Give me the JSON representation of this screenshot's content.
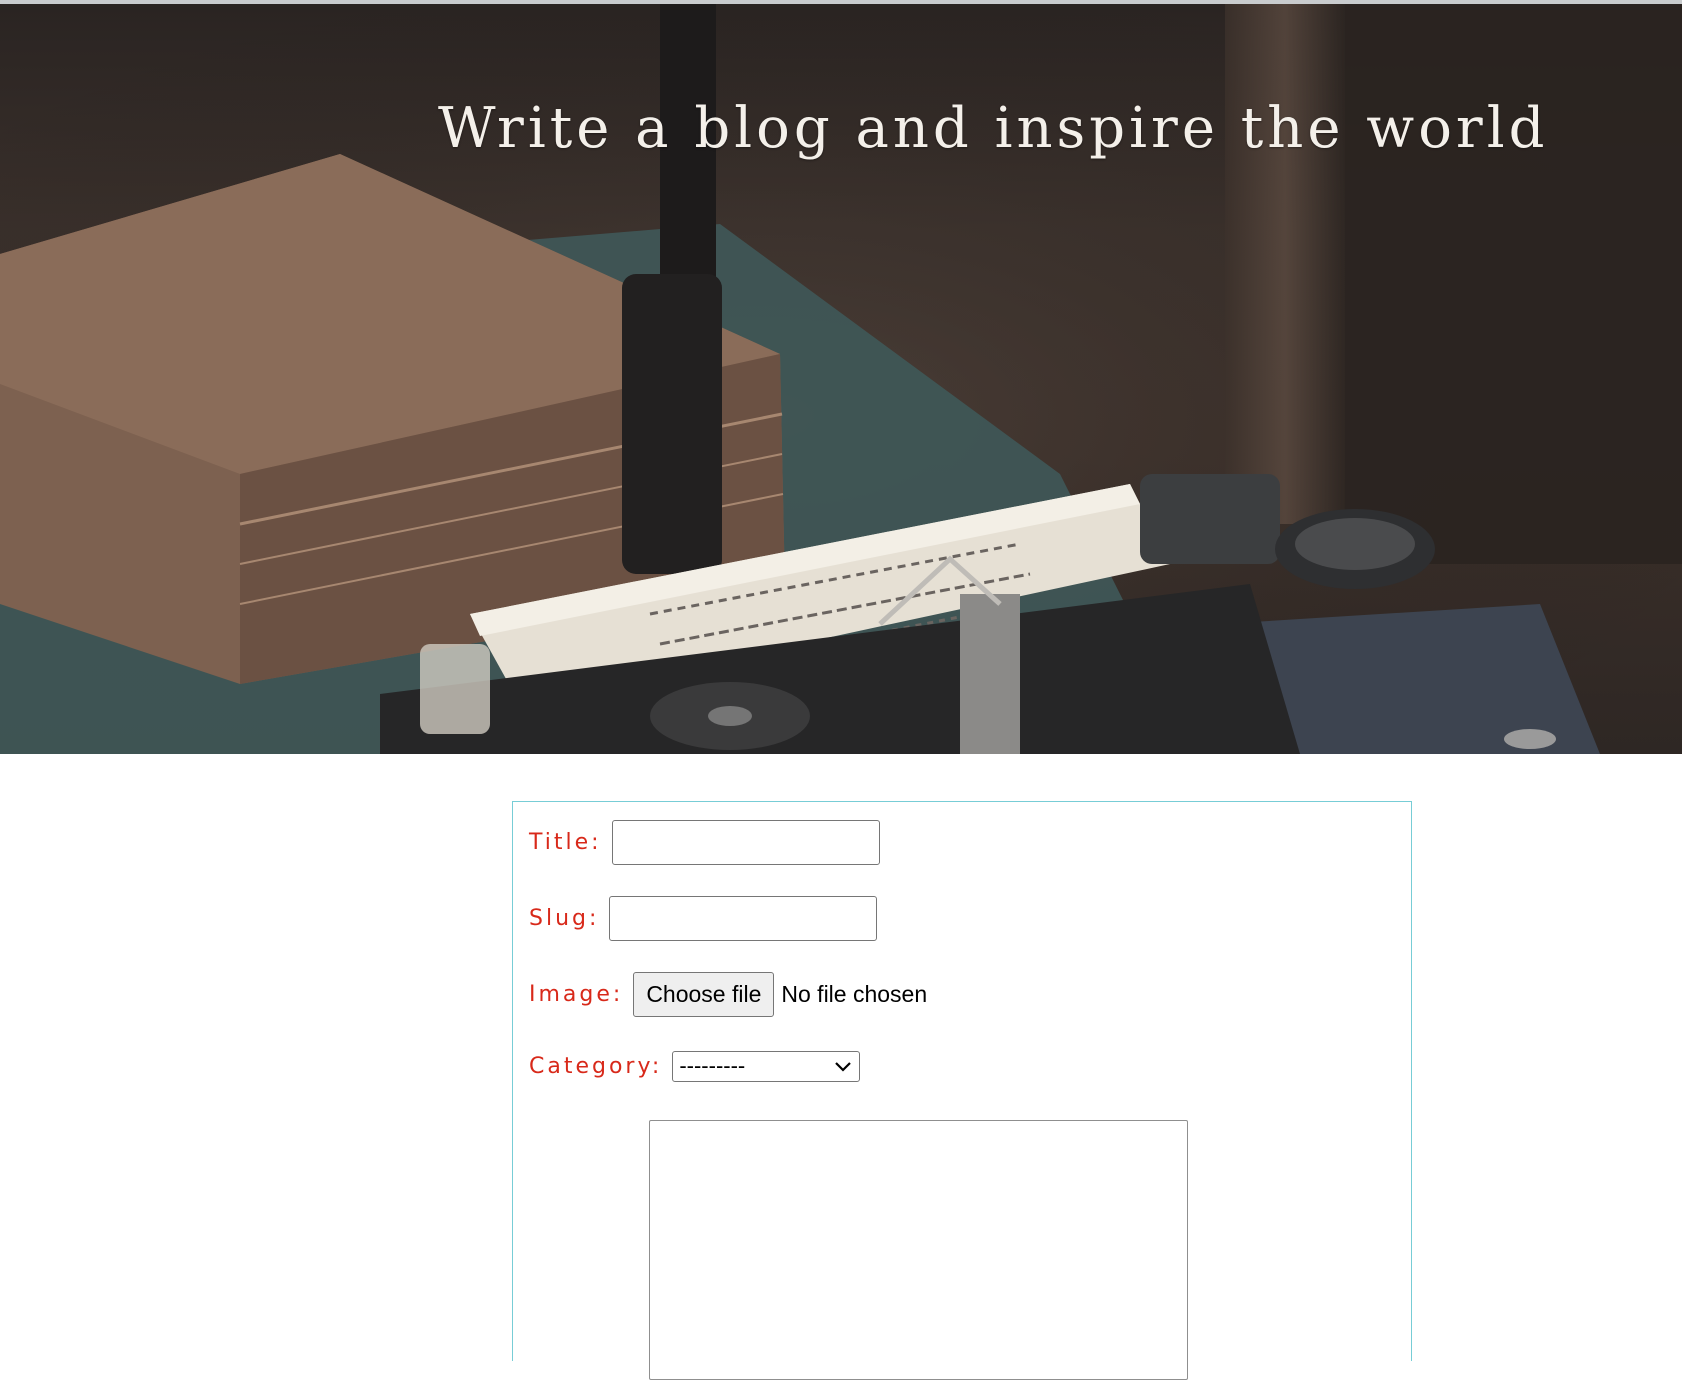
{
  "hero": {
    "title": "Write a blog and inspire the world",
    "image_icon": "typewriter-and-book-photo"
  },
  "form": {
    "title_label": "Title:",
    "title_value": "",
    "slug_label": "Slug:",
    "slug_value": "",
    "image_label": "Image:",
    "file_button_label": "Choose file",
    "file_status": "No file chosen",
    "category_label": "Category:",
    "category_selected": "---------",
    "content_value": ""
  },
  "colors": {
    "label": "#d8291a",
    "form_border": "#77cdd6",
    "hero_title": "#f4f0ea"
  }
}
